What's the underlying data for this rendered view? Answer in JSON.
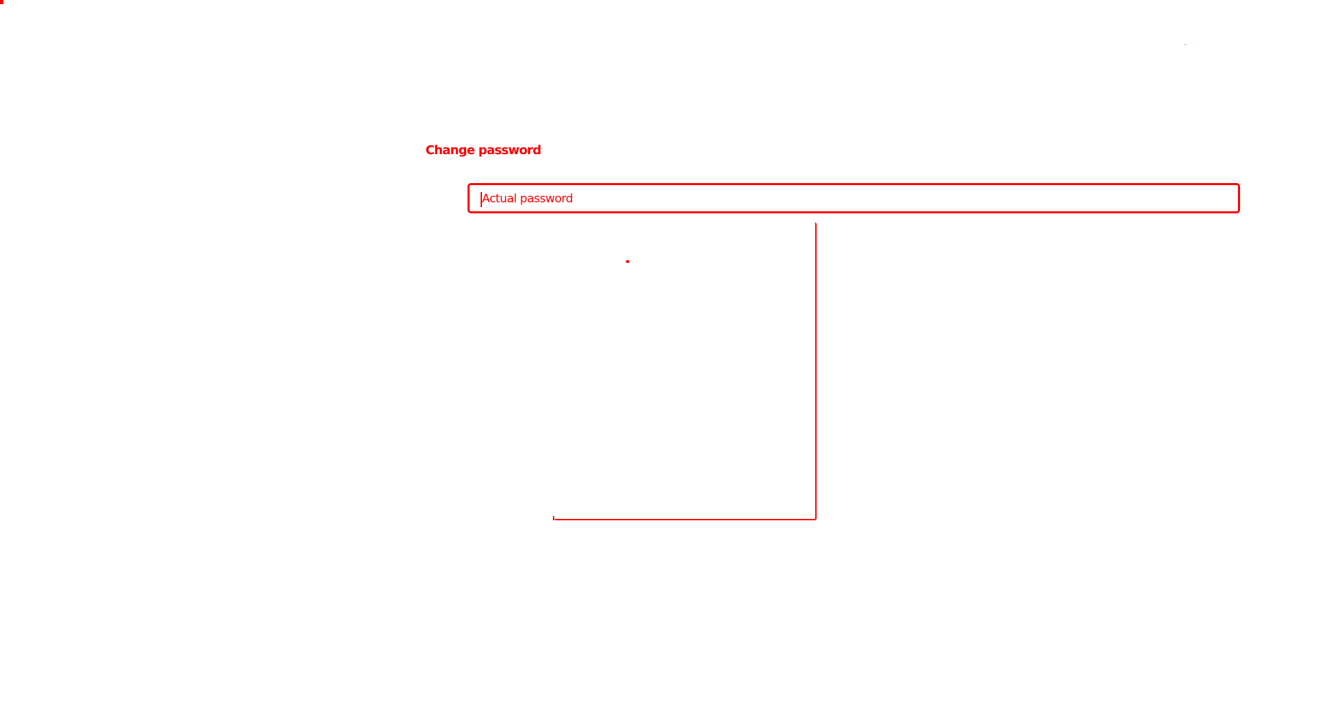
{
  "change_password": {
    "title": "Change password",
    "actual_password": {
      "placeholder": "Actual password",
      "value": ""
    }
  },
  "colors": {
    "outline": "#ff0000",
    "background": "#ffffff"
  },
  "icons": {
    "caret": "text-caret-icon"
  }
}
